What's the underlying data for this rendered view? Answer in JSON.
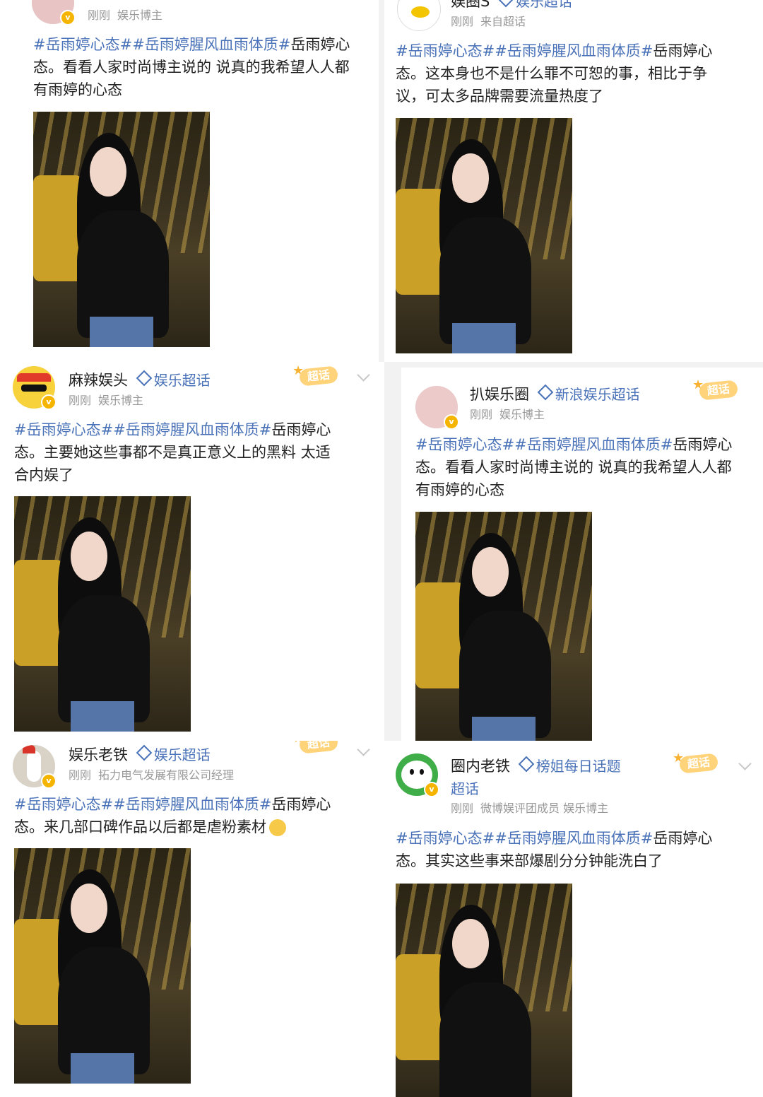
{
  "posts": [
    {
      "name": "",
      "channel": "",
      "time": "刚刚",
      "role": "娱乐博主",
      "text_tags": "#岳雨婷心态##岳雨婷腥风血雨体质#",
      "text_a": "岳雨婷心",
      "text_b": "态。看看人家时尚博主说的 说真的我希望人人都",
      "text_c": "有雨婷的心态"
    },
    {
      "name": "娱圈S",
      "channel": "娱乐超话",
      "time": "刚刚",
      "role": "来自超话",
      "text_tags": "#岳雨婷心态##岳雨婷腥风血雨体质#",
      "text_a": "岳雨婷心",
      "text_b": "态。这本身也不是什么罪不可恕的事，相比于争",
      "text_c": "议，可太多品牌需要流量热度了"
    },
    {
      "name": "麻辣娱头",
      "channel": "娱乐超话",
      "time": "刚刚",
      "role": "娱乐博主",
      "badge": "超话",
      "text_tags": "#岳雨婷心态##岳雨婷腥风血雨体质#",
      "text_a": "岳雨婷心",
      "text_b": "态。主要她这些事都不是真正意义上的黑料 太适",
      "text_c": "合内娱了"
    },
    {
      "name": "扒娱乐圈",
      "channel": "新浪娱乐超话",
      "time": "刚刚",
      "role": "娱乐博主",
      "badge": "超话",
      "text_tags": "#岳雨婷心态##岳雨婷腥风血雨体质#",
      "text_a": "岳雨婷心",
      "text_b": "态。看看人家时尚博主说的 说真的我希望人人都",
      "text_c": "有雨婷的心态"
    },
    {
      "name": "娱乐老铁",
      "channel": "娱乐超话",
      "time": "刚刚",
      "role": "拓力电气发展有限公司经理",
      "badge": "超话",
      "text_tags": "#岳雨婷心态##岳雨婷腥风血雨体质#",
      "text_a": "岳雨婷心",
      "text_b": "态。来几部口碑作品以后都是虐粉素材",
      "text_c": ""
    },
    {
      "name": "圈内老铁",
      "channel": "榜姐每日话题",
      "channel2": "超话",
      "time": "刚刚",
      "role": "微博娱评团成员 娱乐博主",
      "badge": "超话",
      "text_tags": "#岳雨婷心态##岳雨婷腥风血雨体质#",
      "text_a": "岳雨婷心",
      "text_b": "态。其实这些事来部爆剧分分钟能洗白了",
      "text_c": ""
    }
  ],
  "colors": {
    "link": "#4a72b8",
    "badge": "#ffd37a",
    "verified": "#f5b400"
  },
  "icons": [
    "verified-badge-icon",
    "diamond-icon",
    "chevron-down-icon",
    "star-icon",
    "laugh-cry-emoji-icon"
  ]
}
